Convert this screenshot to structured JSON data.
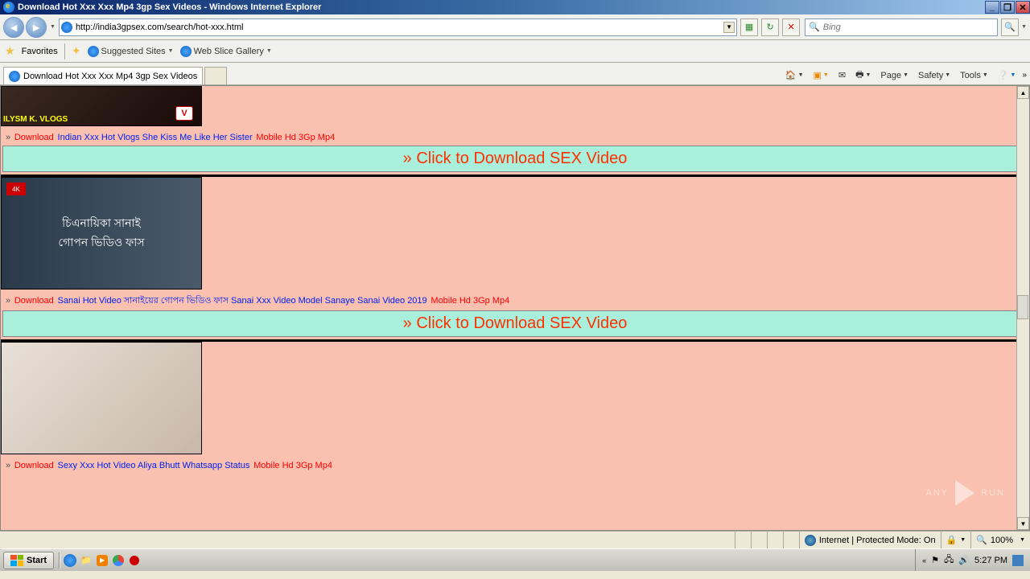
{
  "window": {
    "title": "Download Hot Xxx Xxx Mp4 3gp Sex Videos - Windows Internet Explorer"
  },
  "nav": {
    "url": "http://india3gpsex.com/search/hot-xxx.html",
    "search_placeholder": "Bing"
  },
  "favbar": {
    "favorites": "Favorites",
    "suggested": "Suggested Sites",
    "webslice": "Web Slice Gallery"
  },
  "tab": {
    "title": "Download Hot Xxx Xxx Mp4 3gp Sex Videos"
  },
  "cmd": {
    "page": "Page",
    "safety": "Safety",
    "tools": "Tools"
  },
  "items": [
    {
      "overlay_vlogs": "ILYSM K. VLOGS",
      "title_dl": "Download",
      "title_link": "Indian Xxx Hot Vlogs She Kiss Me Like Her Sister",
      "title_fmt": "Mobile Hd 3Gp Mp4",
      "dlbar": "» Click to Download SEX Video"
    },
    {
      "overlay_bengali": "চিএনায়িকা সানাই\nগোপন ভিডিও ফাস",
      "title_dl": "Download",
      "title_link": "Sanai Hot Video সানাইয়ের গোপন ভিডিও ফাস Sanai Xxx Video Model Sanaye Sanai Video 2019",
      "title_fmt": "Mobile Hd 3Gp Mp4",
      "dlbar": "» Click to Download SEX Video"
    },
    {
      "title_dl": "Download",
      "title_link": "Sexy Xxx Hot Video Aliya Bhutt Whatsapp Status",
      "title_fmt": "Mobile Hd 3Gp Mp4"
    }
  ],
  "status": {
    "zone": "Internet | Protected Mode: On",
    "zoom": "100%"
  },
  "taskbar": {
    "start": "Start",
    "time": "5:27 PM"
  },
  "watermark": {
    "text_a": "ANY",
    "text_b": "RUN"
  }
}
